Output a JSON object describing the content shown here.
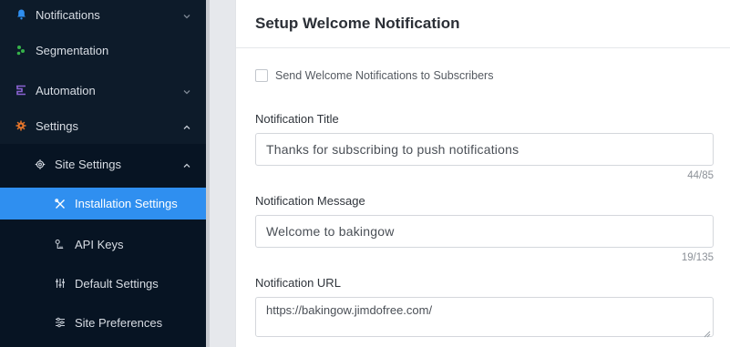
{
  "sidebar": {
    "items": [
      {
        "label": "Notifications",
        "icon": "bell-icon"
      },
      {
        "label": "Segmentation",
        "icon": "segment-dots-icon"
      },
      {
        "label": "Automation",
        "icon": "automation-icon"
      },
      {
        "label": "Settings",
        "icon": "gear-icon"
      }
    ],
    "site_settings": {
      "label": "Site Settings",
      "icon": "gear-outline-icon"
    },
    "sub_items": [
      {
        "label": "Installation Settings",
        "icon": "tools-icon",
        "active": true
      },
      {
        "label": "API Keys",
        "icon": "key-icon"
      },
      {
        "label": "Default Settings",
        "icon": "sliders-icon"
      },
      {
        "label": "Site Preferences",
        "icon": "preferences-icon"
      }
    ]
  },
  "card": {
    "title": "Setup Welcome Notification",
    "checkbox_label": "Send Welcome Notifications to Subscribers",
    "title_label": "Notification Title",
    "title_value": "Thanks for subscribing to push notifications",
    "title_counter": "44/85",
    "message_label": "Notification Message",
    "message_value": "Welcome to bakingow",
    "message_counter": "19/135",
    "url_label": "Notification URL",
    "url_value": "https://bakingow.jimdofree.com/"
  },
  "colors": {
    "sidebar_bg": "#0d1b2a",
    "active_bg": "#2f8ff0",
    "bell": "#2f8ff0",
    "segmentation": "#36b24a",
    "automation": "#8a63d2",
    "settings": "#e7762a"
  }
}
